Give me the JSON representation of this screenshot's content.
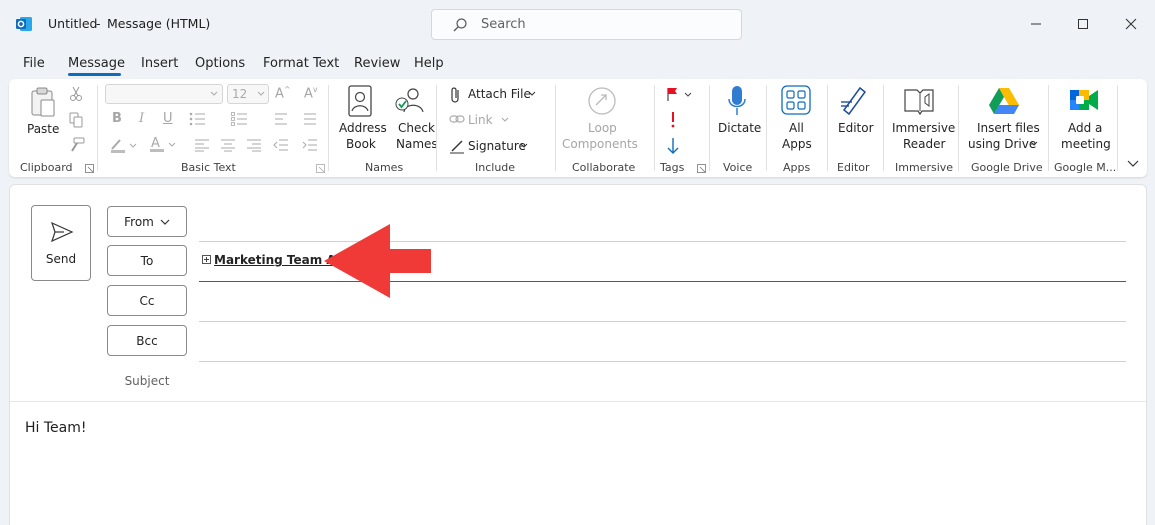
{
  "window": {
    "title_left": "Untitled",
    "title_sep": "-",
    "title_right": "Message (HTML)",
    "search_placeholder": "Search"
  },
  "menu": {
    "tabs": [
      "File",
      "Message",
      "Insert",
      "Options",
      "Format Text",
      "Review",
      "Help"
    ],
    "active_tab": "Message"
  },
  "ribbon": {
    "clipboard": {
      "paste": "Paste",
      "group": "Clipboard"
    },
    "basic_text": {
      "font_size": "12",
      "group": "Basic Text",
      "bold": "B",
      "italic": "I",
      "underline": "U"
    },
    "names": {
      "address_book_1": "Address",
      "address_book_2": "Book",
      "check_names_1": "Check",
      "check_names_2": "Names",
      "group": "Names"
    },
    "include": {
      "attach_file": "Attach File",
      "link": "Link",
      "signature": "Signature",
      "group": "Include"
    },
    "collaborate": {
      "loop_1": "Loop",
      "loop_2": "Components",
      "group": "Collaborate"
    },
    "tags": {
      "group": "Tags"
    },
    "voice": {
      "dictate": "Dictate",
      "group": "Voice"
    },
    "apps": {
      "all_apps_1": "All",
      "all_apps_2": "Apps",
      "group": "Apps"
    },
    "editor": {
      "editor": "Editor",
      "group": "Editor"
    },
    "immersive": {
      "reader_1": "Immersive",
      "reader_2": "Reader",
      "group": "Immersive"
    },
    "google_drive": {
      "insert_1": "Insert files",
      "insert_2": "using Drive",
      "group": "Google Drive"
    },
    "google_meet": {
      "meeting_1": "Add a",
      "meeting_2": "meeting",
      "group": "Google M..."
    }
  },
  "compose": {
    "send": "Send",
    "from": "From",
    "to": "To",
    "cc": "Cc",
    "bcc": "Bcc",
    "subject": "Subject",
    "to_recipient": "Marketing Team A:",
    "body": "Hi Team!"
  },
  "colors": {
    "accent": "#0f6cbd",
    "annotation_arrow": "#f03a38",
    "background": "#eff3f8"
  }
}
